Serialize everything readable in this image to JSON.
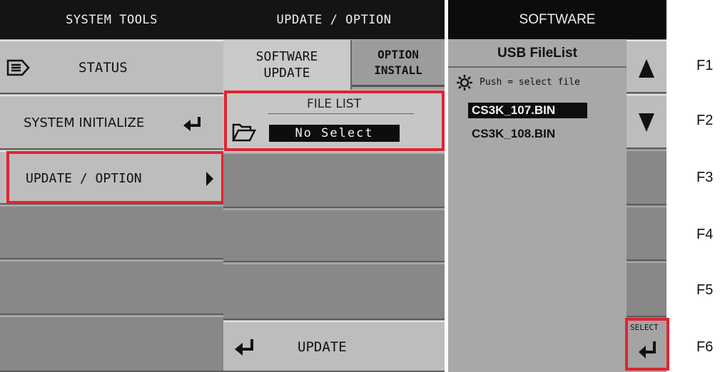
{
  "system_tools": {
    "title": "SYSTEM TOOLS",
    "items": [
      {
        "label": "STATUS"
      },
      {
        "label": "SYSTEM INITIALIZE"
      },
      {
        "label": "UPDATE / OPTION"
      }
    ]
  },
  "update_option": {
    "title": "UPDATE / OPTION",
    "tabs": [
      {
        "line1": "SOFTWARE",
        "line2": "UPDATE"
      },
      {
        "line1": "OPTION",
        "line2": "INSTALL"
      }
    ],
    "file_list_label": "FILE LIST",
    "file_value": "No Select",
    "update_label": "UPDATE"
  },
  "software": {
    "title": "SOFTWARE",
    "usb_title": "USB FileList",
    "hint": "Push = select file",
    "files": [
      "CS3K_107.BIN",
      "CS3K_108.BIN"
    ],
    "select_label": "SELECT"
  },
  "fkeys": [
    "F1",
    "F2",
    "F3",
    "F4",
    "F5",
    "F6"
  ],
  "colors": {
    "highlight": "#e0242f",
    "header": "#141414",
    "panel": "#a3a3a3"
  }
}
